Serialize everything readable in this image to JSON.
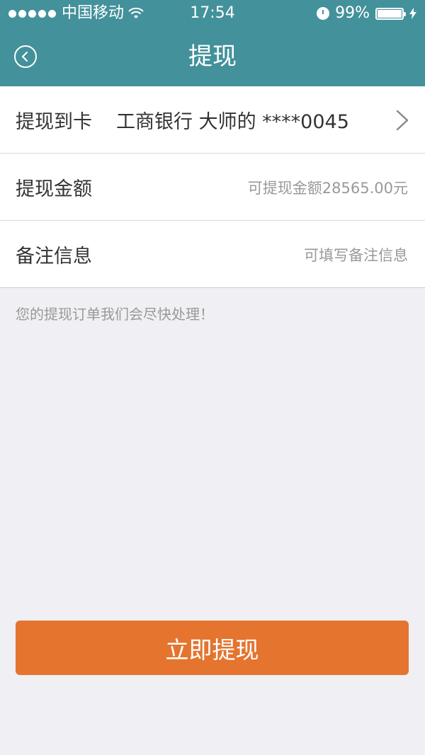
{
  "status_bar": {
    "carrier": "中国移动",
    "time": "17:54",
    "battery_percent": "99%",
    "battery_level": 0.99
  },
  "nav": {
    "title": "提现",
    "back_icon": "back-circle-icon"
  },
  "form": {
    "card_row": {
      "label": "提现到卡",
      "value": "工商银行  大师的 ****0045",
      "icon": "chevron-right-icon"
    },
    "amount_row": {
      "label": "提现金额",
      "placeholder": "可提现金额28565.00元"
    },
    "note_row": {
      "label": "备注信息",
      "placeholder": "可填写备注信息"
    }
  },
  "hint": "您的提现订单我们会尽快处理！",
  "submit_label": "立即提现",
  "colors": {
    "header": "#43919b",
    "button": "#e5742e",
    "background": "#efeff4"
  }
}
